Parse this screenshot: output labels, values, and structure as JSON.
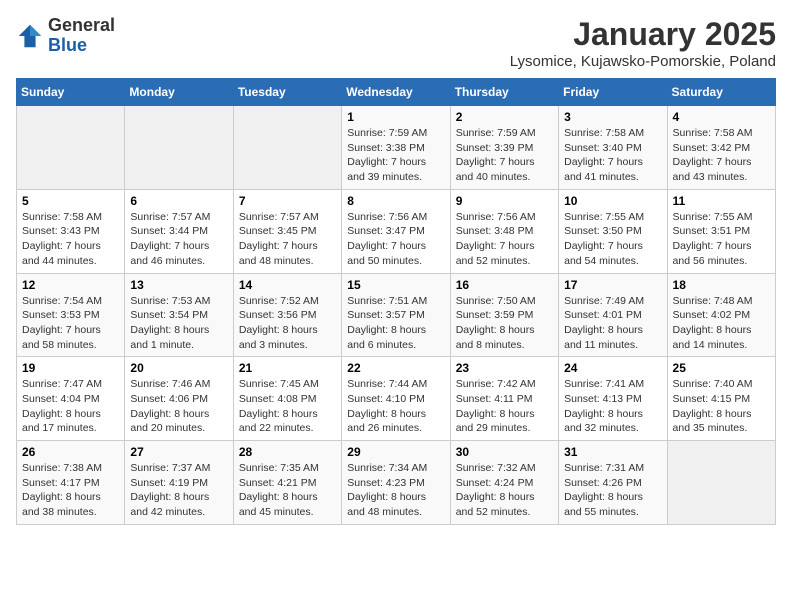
{
  "header": {
    "logo_general": "General",
    "logo_blue": "Blue",
    "month_title": "January 2025",
    "subtitle": "Lysomice, Kujawsko-Pomorskie, Poland"
  },
  "weekdays": [
    "Sunday",
    "Monday",
    "Tuesday",
    "Wednesday",
    "Thursday",
    "Friday",
    "Saturday"
  ],
  "weeks": [
    [
      {
        "day": "",
        "info": ""
      },
      {
        "day": "",
        "info": ""
      },
      {
        "day": "",
        "info": ""
      },
      {
        "day": "1",
        "info": "Sunrise: 7:59 AM\nSunset: 3:38 PM\nDaylight: 7 hours\nand 39 minutes."
      },
      {
        "day": "2",
        "info": "Sunrise: 7:59 AM\nSunset: 3:39 PM\nDaylight: 7 hours\nand 40 minutes."
      },
      {
        "day": "3",
        "info": "Sunrise: 7:58 AM\nSunset: 3:40 PM\nDaylight: 7 hours\nand 41 minutes."
      },
      {
        "day": "4",
        "info": "Sunrise: 7:58 AM\nSunset: 3:42 PM\nDaylight: 7 hours\nand 43 minutes."
      }
    ],
    [
      {
        "day": "5",
        "info": "Sunrise: 7:58 AM\nSunset: 3:43 PM\nDaylight: 7 hours\nand 44 minutes."
      },
      {
        "day": "6",
        "info": "Sunrise: 7:57 AM\nSunset: 3:44 PM\nDaylight: 7 hours\nand 46 minutes."
      },
      {
        "day": "7",
        "info": "Sunrise: 7:57 AM\nSunset: 3:45 PM\nDaylight: 7 hours\nand 48 minutes."
      },
      {
        "day": "8",
        "info": "Sunrise: 7:56 AM\nSunset: 3:47 PM\nDaylight: 7 hours\nand 50 minutes."
      },
      {
        "day": "9",
        "info": "Sunrise: 7:56 AM\nSunset: 3:48 PM\nDaylight: 7 hours\nand 52 minutes."
      },
      {
        "day": "10",
        "info": "Sunrise: 7:55 AM\nSunset: 3:50 PM\nDaylight: 7 hours\nand 54 minutes."
      },
      {
        "day": "11",
        "info": "Sunrise: 7:55 AM\nSunset: 3:51 PM\nDaylight: 7 hours\nand 56 minutes."
      }
    ],
    [
      {
        "day": "12",
        "info": "Sunrise: 7:54 AM\nSunset: 3:53 PM\nDaylight: 7 hours\nand 58 minutes."
      },
      {
        "day": "13",
        "info": "Sunrise: 7:53 AM\nSunset: 3:54 PM\nDaylight: 8 hours\nand 1 minute."
      },
      {
        "day": "14",
        "info": "Sunrise: 7:52 AM\nSunset: 3:56 PM\nDaylight: 8 hours\nand 3 minutes."
      },
      {
        "day": "15",
        "info": "Sunrise: 7:51 AM\nSunset: 3:57 PM\nDaylight: 8 hours\nand 6 minutes."
      },
      {
        "day": "16",
        "info": "Sunrise: 7:50 AM\nSunset: 3:59 PM\nDaylight: 8 hours\nand 8 minutes."
      },
      {
        "day": "17",
        "info": "Sunrise: 7:49 AM\nSunset: 4:01 PM\nDaylight: 8 hours\nand 11 minutes."
      },
      {
        "day": "18",
        "info": "Sunrise: 7:48 AM\nSunset: 4:02 PM\nDaylight: 8 hours\nand 14 minutes."
      }
    ],
    [
      {
        "day": "19",
        "info": "Sunrise: 7:47 AM\nSunset: 4:04 PM\nDaylight: 8 hours\nand 17 minutes."
      },
      {
        "day": "20",
        "info": "Sunrise: 7:46 AM\nSunset: 4:06 PM\nDaylight: 8 hours\nand 20 minutes."
      },
      {
        "day": "21",
        "info": "Sunrise: 7:45 AM\nSunset: 4:08 PM\nDaylight: 8 hours\nand 22 minutes."
      },
      {
        "day": "22",
        "info": "Sunrise: 7:44 AM\nSunset: 4:10 PM\nDaylight: 8 hours\nand 26 minutes."
      },
      {
        "day": "23",
        "info": "Sunrise: 7:42 AM\nSunset: 4:11 PM\nDaylight: 8 hours\nand 29 minutes."
      },
      {
        "day": "24",
        "info": "Sunrise: 7:41 AM\nSunset: 4:13 PM\nDaylight: 8 hours\nand 32 minutes."
      },
      {
        "day": "25",
        "info": "Sunrise: 7:40 AM\nSunset: 4:15 PM\nDaylight: 8 hours\nand 35 minutes."
      }
    ],
    [
      {
        "day": "26",
        "info": "Sunrise: 7:38 AM\nSunset: 4:17 PM\nDaylight: 8 hours\nand 38 minutes."
      },
      {
        "day": "27",
        "info": "Sunrise: 7:37 AM\nSunset: 4:19 PM\nDaylight: 8 hours\nand 42 minutes."
      },
      {
        "day": "28",
        "info": "Sunrise: 7:35 AM\nSunset: 4:21 PM\nDaylight: 8 hours\nand 45 minutes."
      },
      {
        "day": "29",
        "info": "Sunrise: 7:34 AM\nSunset: 4:23 PM\nDaylight: 8 hours\nand 48 minutes."
      },
      {
        "day": "30",
        "info": "Sunrise: 7:32 AM\nSunset: 4:24 PM\nDaylight: 8 hours\nand 52 minutes."
      },
      {
        "day": "31",
        "info": "Sunrise: 7:31 AM\nSunset: 4:26 PM\nDaylight: 8 hours\nand 55 minutes."
      },
      {
        "day": "",
        "info": ""
      }
    ]
  ]
}
